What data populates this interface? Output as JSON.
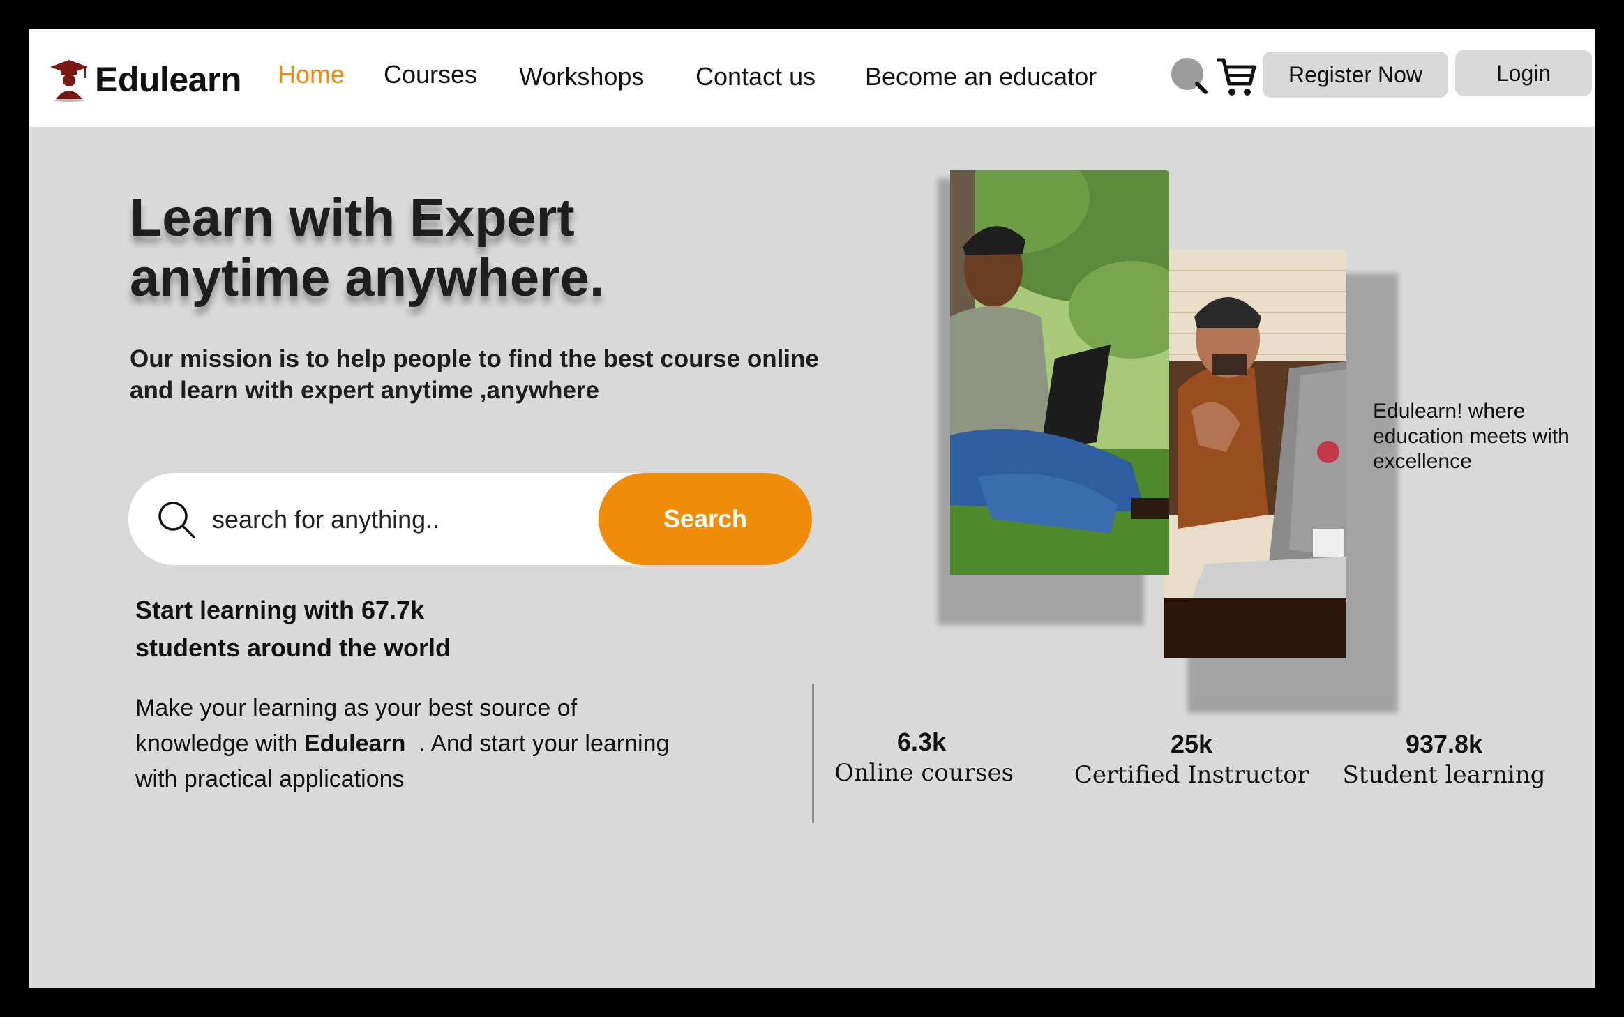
{
  "brand": {
    "name": "Edulearn",
    "logo_icon": "graduate-icon"
  },
  "nav": {
    "links": [
      "Home",
      "Courses",
      "Workshops",
      "Contact us",
      "Become an educator"
    ],
    "active": "Home",
    "register_label": "Register Now",
    "login_label": "Login"
  },
  "hero": {
    "title_line1": "Learn with Expert",
    "title_line2": "anytime anywhere.",
    "subtitle_line1": "Our mission is to help people to find the best course online",
    "subtitle_line2": "and learn with expert anytime ,anywhere"
  },
  "search": {
    "placeholder": "search for anything..",
    "button_label": "Search"
  },
  "students": {
    "line1": "Start learning with 67.7k",
    "line2": "students around the world"
  },
  "make_text": {
    "line1": "Make your learning as your best source of",
    "line2_pre": "knowledge with ",
    "line2_brand": "Edulearn",
    "line2_post": "  . And start your learning",
    "line3": "with practical applications"
  },
  "stats": [
    {
      "value": "6.3k",
      "label": "Online courses"
    },
    {
      "value": "25k",
      "label": "Certified Instructor"
    },
    {
      "value": "937.8k",
      "label": "Student learning"
    }
  ],
  "caption": {
    "line1": "Edulearn! where",
    "line2": "education meets with",
    "line3": "excellence"
  },
  "colors": {
    "accent": "#ef8c0a",
    "background": "#d9d9d9",
    "nav_bg": "#ffffff"
  }
}
